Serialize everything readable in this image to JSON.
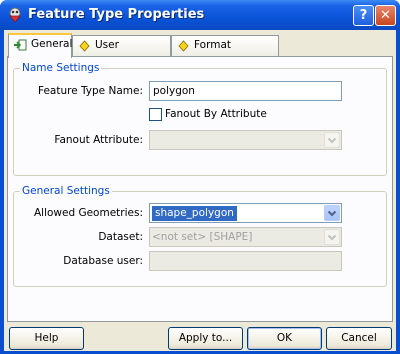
{
  "window": {
    "title": "Feature Type Properties"
  },
  "titlebar_buttons": {
    "help": "?",
    "close": "✕"
  },
  "tabs": [
    {
      "label": "General",
      "icon": "general-tab-icon",
      "active": true
    },
    {
      "label": "User Attributes",
      "icon": "diamond-icon",
      "active": false
    },
    {
      "label": "Format Attributes",
      "icon": "diamond-icon",
      "active": false
    }
  ],
  "name_settings": {
    "title": "Name Settings",
    "feature_type_name_label": "Feature Type Name:",
    "feature_type_name_value": "polygon",
    "fanout_checkbox_label": "Fanout By Attribute",
    "fanout_checked": false,
    "fanout_attribute_label": "Fanout Attribute:",
    "fanout_attribute_value": ""
  },
  "general_settings": {
    "title": "General Settings",
    "allowed_geometries_label": "Allowed Geometries:",
    "allowed_geometries_value": "shape_polygon",
    "dataset_label": "Dataset:",
    "dataset_value": "<not set> [SHAPE]",
    "database_user_label": "Database user:",
    "database_user_value": ""
  },
  "footer": {
    "help": "Help",
    "apply": "Apply to...",
    "ok": "OK",
    "cancel": "Cancel"
  },
  "colors": {
    "titlebar": "#0a53d8",
    "dialog_bg": "#ece9d8",
    "group_title": "#0046d5",
    "selection": "#316ac5"
  }
}
